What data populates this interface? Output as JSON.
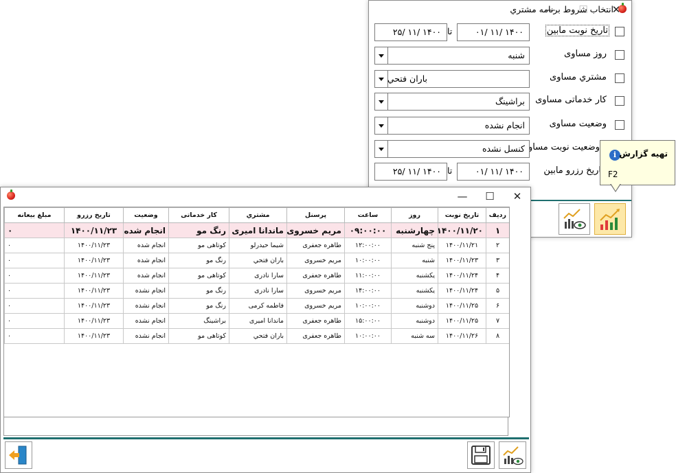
{
  "filter_window": {
    "title": "انتخاب شروط برنامه مشتري",
    "rows": [
      {
        "label": "تاريخ نوبت مابين",
        "from": "۱۴۰۰ /۱۱ /۰۱",
        "to_word": "تا",
        "to": "۱۴۰۰ /۱۱ /۲۵"
      },
      {
        "label": "روز مساوی",
        "value": "شنبه"
      },
      {
        "label": "مشتري مساوی",
        "value": "باران فتحي"
      },
      {
        "label": "کار خدماتی مساوی",
        "value": "براشينگ"
      },
      {
        "label": "وضعيت مساوی",
        "value": "انجام نشده"
      },
      {
        "label": "وضعيت نوبت مساوی",
        "value": "کنسل نشده"
      },
      {
        "label": "تاريخ رزرو مابين",
        "from": "۱۴۰۰ /۱۱ /۰۱",
        "to_word": "تا",
        "to": "۱۴۰۰ /۱۱ /۲۵"
      }
    ]
  },
  "tooltip": {
    "title": "تهيه گزارش",
    "shortcut": "F2"
  },
  "report_window": {
    "columns": [
      "رديف",
      "تاريخ نوبت",
      "روز",
      "ساعت",
      "پرسنل",
      "مشتري",
      "کار خدماتی",
      "وضعيت",
      "تاريخ رزرو",
      "مبلغ بيعانه"
    ],
    "rows": [
      [
        "۱",
        "۱۴۰۰/۱۱/۲۰",
        "چهارشنبه",
        "۰۹:۰۰:۰۰",
        "مريم خسروی",
        "ماندانا اميری",
        "رنگ مو",
        "انجام شده",
        "۱۴۰۰/۱۱/۲۳",
        "۰"
      ],
      [
        "۲",
        "۱۴۰۰/۱۱/۲۱",
        "پنج شنبه",
        "۱۲:۰۰:۰۰",
        "طاهره جعفری",
        "شيما حيدرلو",
        "کوتاهی مو",
        "انجام شده",
        "۱۴۰۰/۱۱/۲۳",
        "۰"
      ],
      [
        "۳",
        "۱۴۰۰/۱۱/۲۳",
        "شنبه",
        "۱۰:۰۰:۰۰",
        "مريم خسروی",
        "باران فتحي",
        "رنگ مو",
        "انجام شده",
        "۱۴۰۰/۱۱/۲۳",
        "۰"
      ],
      [
        "۴",
        "۱۴۰۰/۱۱/۲۴",
        "يکشنبه",
        "۱۱:۰۰:۰۰",
        "طاهره جعفری",
        "سارا نادری",
        "کوتاهی مو",
        "انجام شده",
        "۱۴۰۰/۱۱/۲۳",
        "۰"
      ],
      [
        "۵",
        "۱۴۰۰/۱۱/۲۴",
        "يکشنبه",
        "۱۴:۰۰:۰۰",
        "مريم خسروی",
        "سارا نادری",
        "رنگ مو",
        "انجام نشده",
        "۱۴۰۰/۱۱/۲۳",
        "۰"
      ],
      [
        "۶",
        "۱۴۰۰/۱۱/۲۵",
        "دوشنبه",
        "۱۰:۰۰:۰۰",
        "مريم خسروی",
        "فاطمه کرمی",
        "رنگ مو",
        "انجام نشده",
        "۱۴۰۰/۱۱/۲۳",
        "۰"
      ],
      [
        "۷",
        "۱۴۰۰/۱۱/۲۵",
        "دوشنبه",
        "۱۵:۰۰:۰۰",
        "طاهره جعفری",
        "ماندانا اميری",
        "براشينگ",
        "انجام نشده",
        "۱۴۰۰/۱۱/۲۳",
        "۰"
      ],
      [
        "۸",
        "۱۴۰۰/۱۱/۲۶",
        "سه شنبه",
        "۱۰:۰۰:۰۰",
        "طاهره جعفری",
        "باران فتحي",
        "کوتاهی مو",
        "انجام نشده",
        "۱۴۰۰/۱۱/۲۳",
        "۰"
      ]
    ]
  }
}
